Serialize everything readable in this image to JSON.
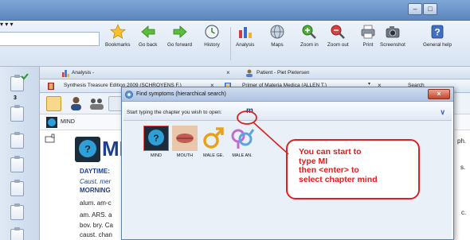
{
  "ribbon": {
    "bookmarks": "Bookmarks",
    "go_back": "Go back",
    "go_forward": "Go forward",
    "history": "History",
    "analysis": "Analysis",
    "maps": "Maps",
    "zoom_in": "Zoom in",
    "zoom_out": "Zoom out",
    "print": "Print",
    "screenshot": "Screenshot",
    "general_help": "General help"
  },
  "left_strip": {
    "badge": "3"
  },
  "tabs_row1": {
    "analysis": "Analysis -",
    "patient": "Patient - Piet Pietersen"
  },
  "tabs_row2": {
    "synthesis": "Synthesis Treasure Edition 2009 (SCHROYENS F.)",
    "primer": "Primer of Materia Medica (ALLEN T.)",
    "search": "Search"
  },
  "chapter_row": {
    "label": "MIND"
  },
  "content": {
    "big_title": "MI",
    "lines": [
      {
        "text": "DAYTIME:",
        "color": "#1c3f8f",
        "bold": true,
        "italic": false
      },
      {
        "text": "Caust. mer",
        "color": "#1c3f8f",
        "bold": false,
        "italic": true
      },
      {
        "text": "MORNING",
        "color": "#1c3f8f",
        "bold": true,
        "italic": false
      },
      {
        "text": "alum. am-c",
        "color": "#222222",
        "bold": false,
        "italic": false
      },
      {
        "text": "am. ARS. a",
        "color": "#222222",
        "bold": false,
        "italic": false
      },
      {
        "text": "bov. bry. Ca",
        "color": "#222222",
        "bold": false,
        "italic": false
      },
      {
        "text": "caust. chan",
        "color": "#222222",
        "bold": false,
        "italic": false
      }
    ],
    "right_fragments": [
      "ph.",
      "s.",
      "c."
    ]
  },
  "dialog": {
    "title": "Find symptoms (hierarchical search)",
    "prompt": "Start typing the chapter you wish to open:",
    "typed": "m",
    "chapters": [
      "MIND",
      "MOUTH",
      "MALE GE.",
      "MALE AN."
    ]
  },
  "callout": {
    "text": "You can start to type  MI then <enter> to select chapter mind"
  },
  "colors": {
    "callout_red": "#e21b1b",
    "accent_blue": "#1c3f8f"
  }
}
